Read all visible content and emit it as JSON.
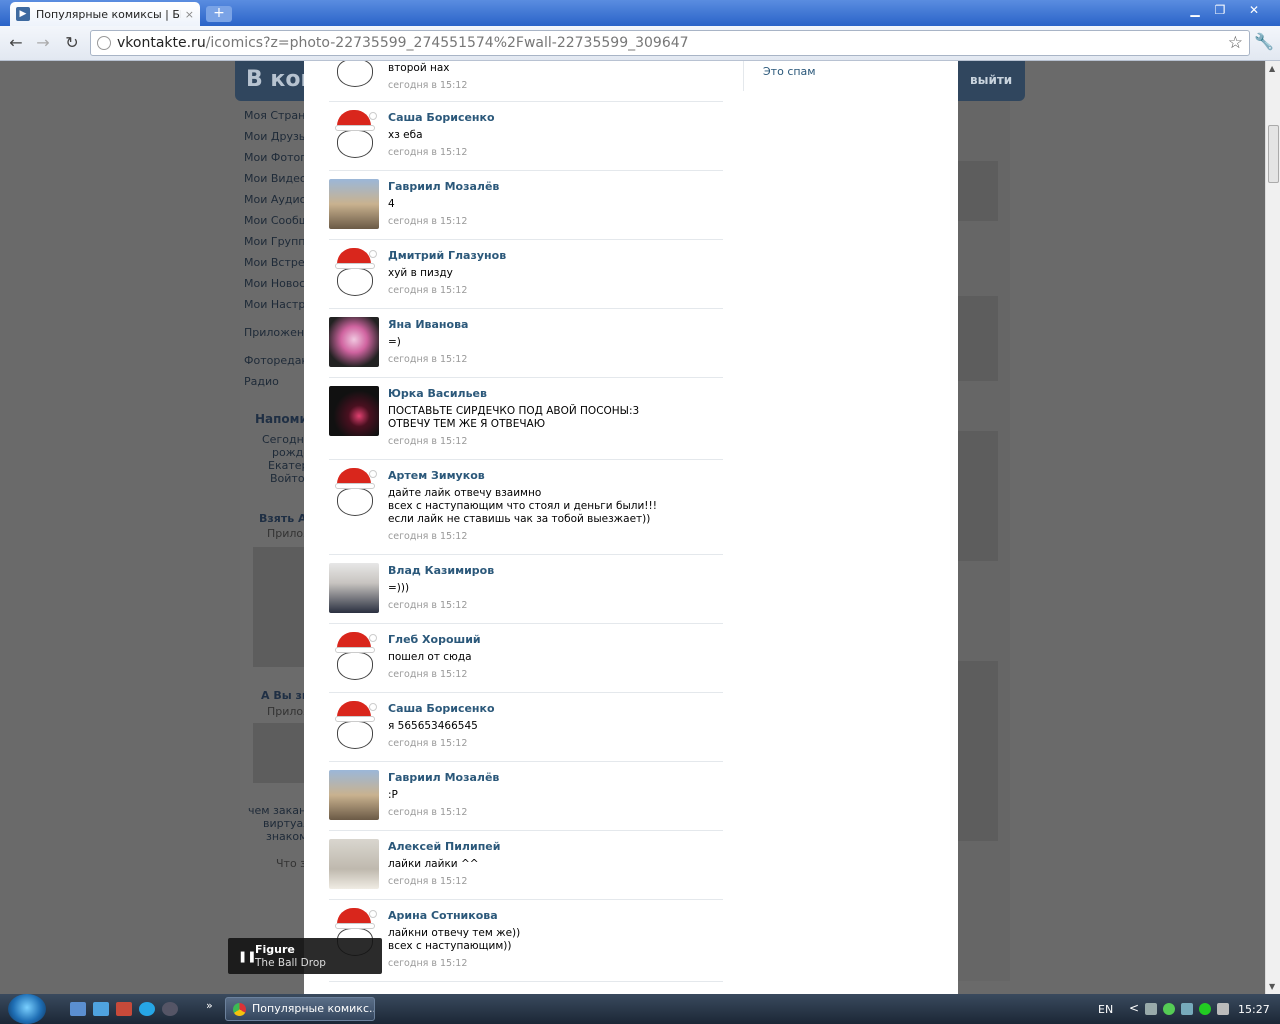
{
  "browser": {
    "tab_title": "Популярные комиксы | БЕЗ В",
    "tab_close": "×",
    "new_tab": "+",
    "url_host": "vkontakte.ru",
    "url_rest": "/icomics?z=photo-22735599_274551574%2Fwall-22735599_309647",
    "window_controls": [
      "minimize-icon",
      "restore-icon",
      "close-icon"
    ]
  },
  "vk_background": {
    "logo": "В кон",
    "exit_link": "выйти",
    "menu": [
      "Моя Страни",
      "Мои Друзья",
      "Мои Фотогр",
      "Мои Видеоз",
      "Мои Аудиоз",
      "Мои Сообщ",
      "Мои Группы",
      "Мои Встречи",
      "Мои Новост",
      "Мои Настро",
      "Приложени",
      "Фоторедакт",
      "Радио"
    ],
    "reminders_title": "Напоми",
    "reminder_lines": [
      "Сегодня",
      "рожде",
      "Екатер",
      "Войтов"
    ],
    "ad1_title": "Взять А",
    "ad1_sub": "Прилож",
    "ad2_title": "А Вы зн",
    "ad2_sub": "Прилож",
    "ad2_text": [
      "чем заканч",
      "виртуал",
      "знаком"
    ],
    "more": "Что з"
  },
  "viewer": {
    "spam_link": "Это спам",
    "first_comment": {
      "text": "второй нах",
      "time": "сегодня в 15:12"
    },
    "comments": [
      {
        "avatar": "santa",
        "name": "Саша Борисенко",
        "text": "хз еба",
        "time": "сегодня в 15:12"
      },
      {
        "avatar": "photo-a",
        "name": "Гавриил Мозалёв",
        "text": "4",
        "time": "сегодня в 15:12"
      },
      {
        "avatar": "santa",
        "name": "Дмитрий Глазунов",
        "text": "хуй в пизду",
        "time": "сегодня в 15:12"
      },
      {
        "avatar": "photo-b",
        "name": "Яна Иванова",
        "text": "=)",
        "time": "сегодня в 15:12"
      },
      {
        "avatar": "photo-c",
        "name": "Юрка Васильев",
        "text": "ПОСТАВЬТЕ СИРДЕЧКО ПОД АВОЙ ПОСОНЫ:3\nОТВЕЧУ ТЕМ ЖЕ Я ОТВЕЧАЮ",
        "time": "сегодня в 15:12"
      },
      {
        "avatar": "santa",
        "name": "Артем Зимуков",
        "text": "дайте лайк отвечу взаимно\nвсех с наступающим что стоял и деньги были!!!\nесли лайк не ставишь чак за тобой выезжает))",
        "time": "сегодня в 15:12"
      },
      {
        "avatar": "photo-d",
        "name": "Влад Казимиров",
        "text": "=)))",
        "time": "сегодня в 15:12"
      },
      {
        "avatar": "santa",
        "name": "Глеб Хороший",
        "text": "пошел от сюда",
        "time": "сегодня в 15:12"
      },
      {
        "avatar": "santa",
        "name": "Саша Борисенко",
        "text": "я 565653466545",
        "time": "сегодня в 15:12"
      },
      {
        "avatar": "photo-a",
        "name": "Гавриил Мозалёв",
        "text": ":P",
        "time": "сегодня в 15:12"
      },
      {
        "avatar": "photo-e",
        "name": "Алексей Пилипей",
        "text": "лайки лайки ^^",
        "time": "сегодня в 15:12"
      },
      {
        "avatar": "santa",
        "name": "Арина Сотникова",
        "text": "лайкни отвечу тем же))\nвсех с наступающим))",
        "time": "сегодня в 15:12"
      }
    ]
  },
  "media_notification": {
    "title": "Figure",
    "subtitle": "The Ball Drop",
    "pause_symbol": "❚❚"
  },
  "taskbar": {
    "task_label": "Популярные комикс...",
    "language": "EN",
    "clock": "15:27",
    "tray_arrow": "<",
    "quicklaunch_more": "»"
  },
  "colors": {
    "vk_link": "#2b587a",
    "time_gray": "#999999",
    "taskbar": "#1b2736"
  }
}
